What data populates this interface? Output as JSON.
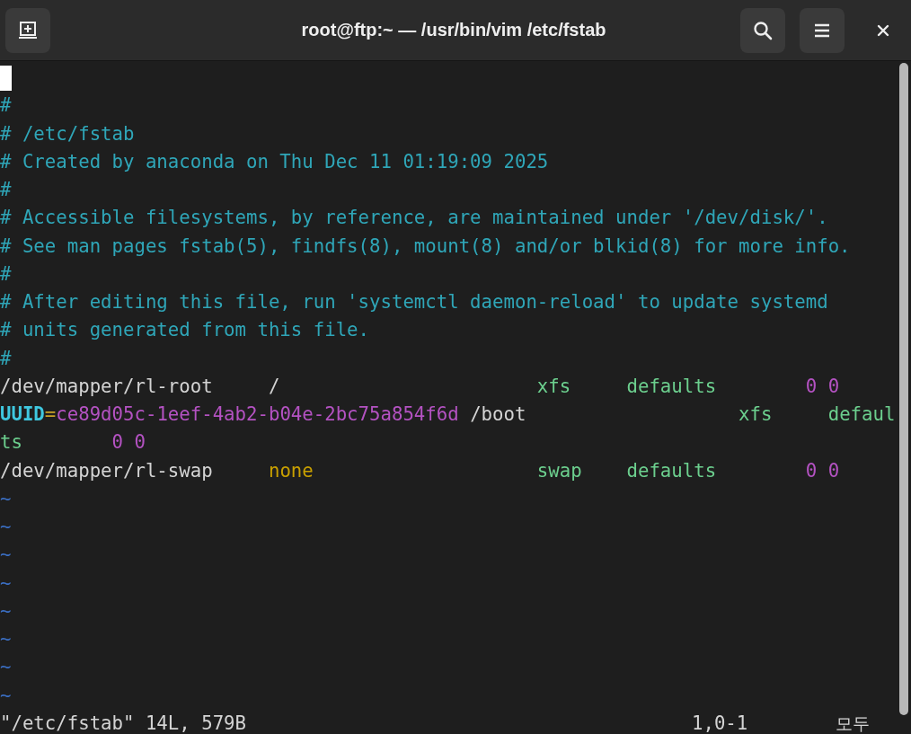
{
  "window": {
    "title": "root@ftp:~ — /usr/bin/vim /etc/fstab"
  },
  "editor": {
    "lines": [
      {
        "kind": "cursor"
      },
      {
        "kind": "text",
        "segments": [
          {
            "text": "#",
            "kind": "comment"
          }
        ]
      },
      {
        "kind": "text",
        "segments": [
          {
            "text": "# /etc/fstab",
            "kind": "comment"
          }
        ]
      },
      {
        "kind": "text",
        "segments": [
          {
            "text": "# Created by anaconda on Thu Dec 11 01:19:09 2025",
            "kind": "comment"
          }
        ]
      },
      {
        "kind": "text",
        "segments": [
          {
            "text": "#",
            "kind": "comment"
          }
        ]
      },
      {
        "kind": "text",
        "segments": [
          {
            "text": "# Accessible filesystems, by reference, are maintained under '/dev/disk/'.",
            "kind": "comment"
          }
        ]
      },
      {
        "kind": "text",
        "segments": [
          {
            "text": "# See man pages fstab(5), findfs(8), mount(8) and/or blkid(8) for more info.",
            "kind": "comment"
          }
        ]
      },
      {
        "kind": "text",
        "segments": [
          {
            "text": "#",
            "kind": "comment"
          }
        ]
      },
      {
        "kind": "text",
        "segments": [
          {
            "text": "# After editing this file, run 'systemctl daemon-reload' to update systemd",
            "kind": "comment"
          }
        ]
      },
      {
        "kind": "text",
        "segments": [
          {
            "text": "# units generated from this file.",
            "kind": "comment"
          }
        ]
      },
      {
        "kind": "text",
        "segments": [
          {
            "text": "#",
            "kind": "comment"
          }
        ]
      },
      {
        "kind": "text",
        "segments": [
          {
            "text": "/dev/mapper/rl-root     /",
            "kind": "plain"
          },
          {
            "text": "                       xfs",
            "kind": "type"
          },
          {
            "text": "     defaults",
            "kind": "type"
          },
          {
            "text": "        0 0",
            "kind": "number"
          }
        ]
      },
      {
        "kind": "text",
        "segments": [
          {
            "text": "UUID",
            "kind": "keyword"
          },
          {
            "text": "=",
            "kind": "operator"
          },
          {
            "text": "ce89d05c-1eef-4ab2-b04e-2bc75a854f6d",
            "kind": "number"
          },
          {
            "text": " /boot",
            "kind": "plain"
          },
          {
            "text": "                   xfs",
            "kind": "type"
          },
          {
            "text": "     defaul",
            "kind": "type"
          }
        ]
      },
      {
        "kind": "text",
        "segments": [
          {
            "text": "ts",
            "kind": "type"
          },
          {
            "text": "        0 0",
            "kind": "number"
          }
        ]
      },
      {
        "kind": "text",
        "segments": [
          {
            "text": "/dev/mapper/rl-swap",
            "kind": "plain"
          },
          {
            "text": "     none",
            "kind": "special"
          },
          {
            "text": "                    swap",
            "kind": "type"
          },
          {
            "text": "    defaults",
            "kind": "type"
          },
          {
            "text": "        0 0",
            "kind": "number"
          }
        ]
      },
      {
        "kind": "filler",
        "segments": [
          {
            "text": "~",
            "kind": "filler"
          }
        ]
      },
      {
        "kind": "filler",
        "segments": [
          {
            "text": "~",
            "kind": "filler"
          }
        ]
      },
      {
        "kind": "filler",
        "segments": [
          {
            "text": "~",
            "kind": "filler"
          }
        ]
      },
      {
        "kind": "filler",
        "segments": [
          {
            "text": "~",
            "kind": "filler"
          }
        ]
      },
      {
        "kind": "filler",
        "segments": [
          {
            "text": "~",
            "kind": "filler"
          }
        ]
      },
      {
        "kind": "filler",
        "segments": [
          {
            "text": "~",
            "kind": "filler"
          }
        ]
      },
      {
        "kind": "filler",
        "segments": [
          {
            "text": "~",
            "kind": "filler"
          }
        ]
      },
      {
        "kind": "filler",
        "segments": [
          {
            "text": "~",
            "kind": "filler"
          }
        ]
      }
    ]
  },
  "status_line": {
    "message": "\"/etc/fstab\" 14L, 579B",
    "position": "1,0-1",
    "scroll": "모두"
  }
}
